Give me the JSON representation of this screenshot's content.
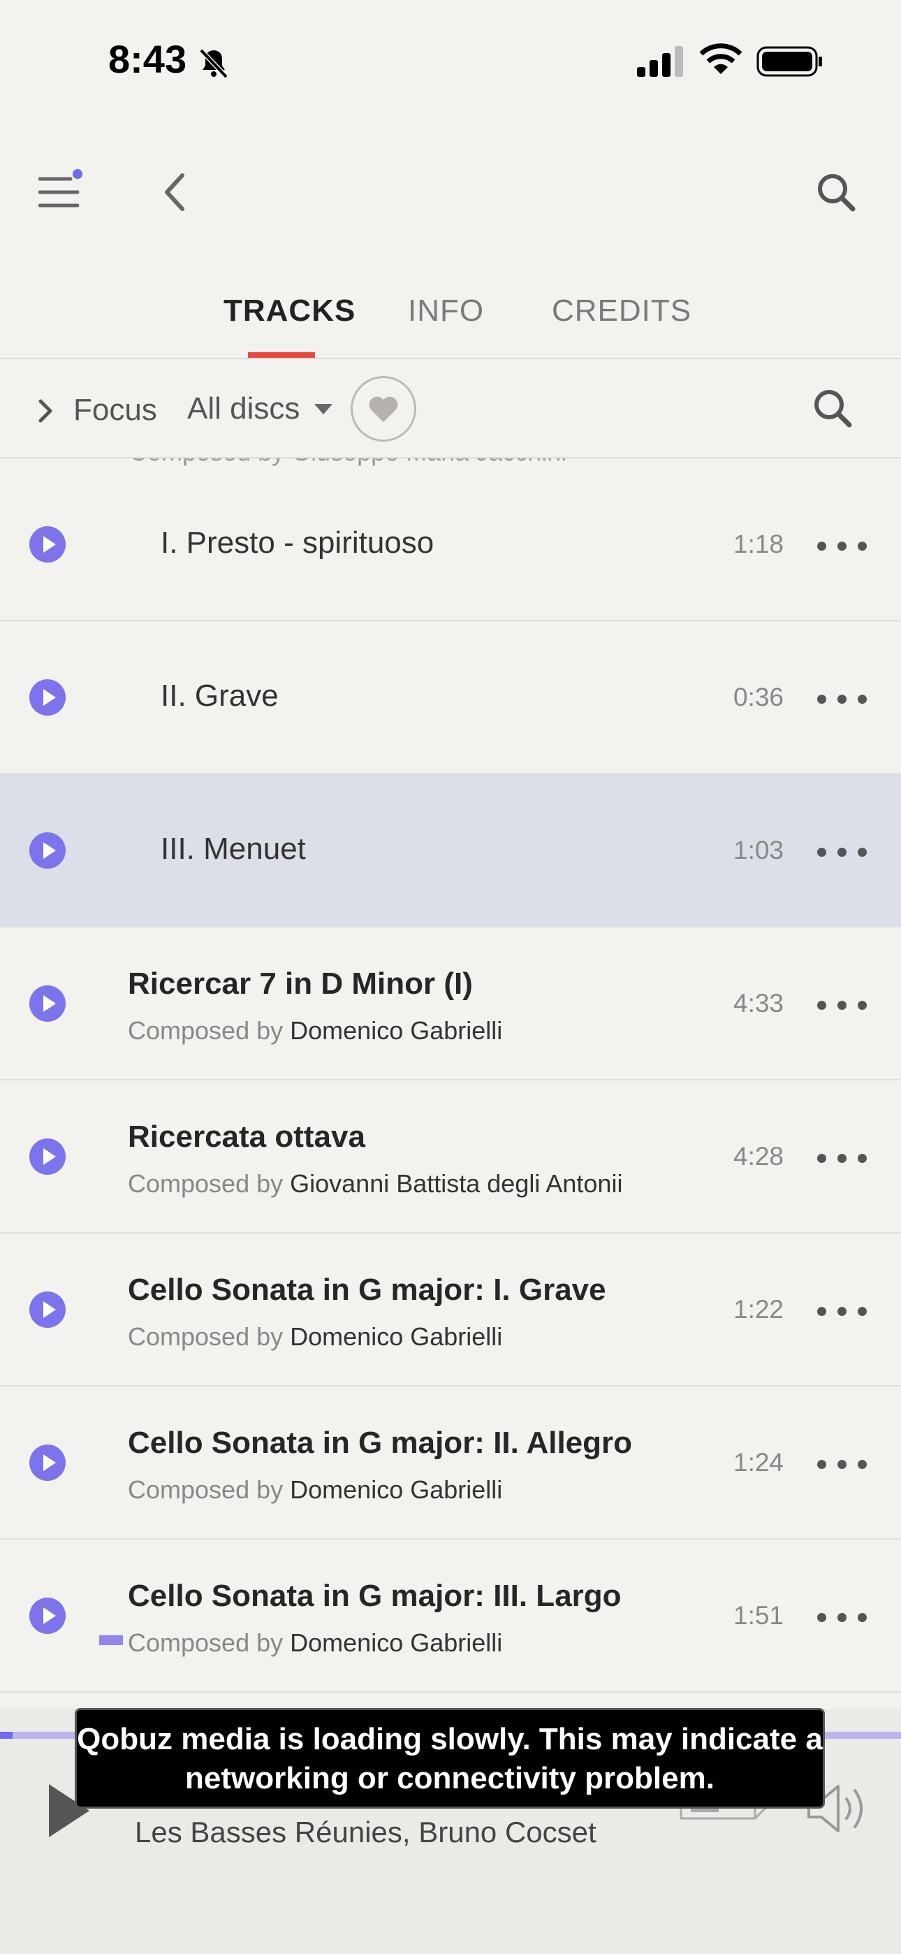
{
  "status": {
    "time": "8:43"
  },
  "tabs": [
    {
      "label": "TRACKS",
      "active": true
    },
    {
      "label": "INFO",
      "active": false
    },
    {
      "label": "CREDITS",
      "active": false
    }
  ],
  "filter": {
    "focus_label": "Focus",
    "discs_label": "All discs"
  },
  "list": {
    "cut_text": "Composed by Giuseppe Maria Jacchini",
    "composer_prefix": "Composed by",
    "rows": [
      {
        "title": "I. Presto - spirituoso",
        "duration": "1:18"
      },
      {
        "title": "II. Grave",
        "duration": "0:36"
      },
      {
        "title": "III. Menuet",
        "duration": "1:03"
      },
      {
        "title": "Ricercar 7 in D Minor (I)",
        "composer": "Domenico Gabrielli",
        "duration": "4:33"
      },
      {
        "title": "Ricercata ottava",
        "composer": "Giovanni Battista degli Antonii",
        "duration": "4:28"
      },
      {
        "title": "Cello Sonata in G major: I. Grave",
        "composer": "Domenico Gabrielli",
        "duration": "1:22"
      },
      {
        "title": "Cello Sonata in G major: II. Allegro",
        "composer": "Domenico Gabrielli",
        "duration": "1:24"
      },
      {
        "title": "Cello Sonata in G major: III. Largo",
        "composer": "Domenico Gabrielli",
        "duration": "1:51"
      }
    ]
  },
  "player": {
    "artist": "Les Basses Réunies, Bruno Cocset"
  },
  "toast": {
    "message": "Qobuz media is loading slowly. This may indicate a networking or connectivity problem."
  },
  "colors": {
    "accent": "#7b74ec",
    "tab_underline": "#e8493f",
    "highlight_row": "#dcdfe8"
  },
  "icons": [
    "bell-slash-icon",
    "signal-icon",
    "wifi-icon",
    "battery-icon",
    "hamburger-menu-icon",
    "back-chevron-icon",
    "search-icon",
    "chevron-right-icon",
    "caret-down-icon",
    "heart-icon",
    "play-icon",
    "more-dots-icon",
    "device-icon",
    "volume-icon"
  ]
}
